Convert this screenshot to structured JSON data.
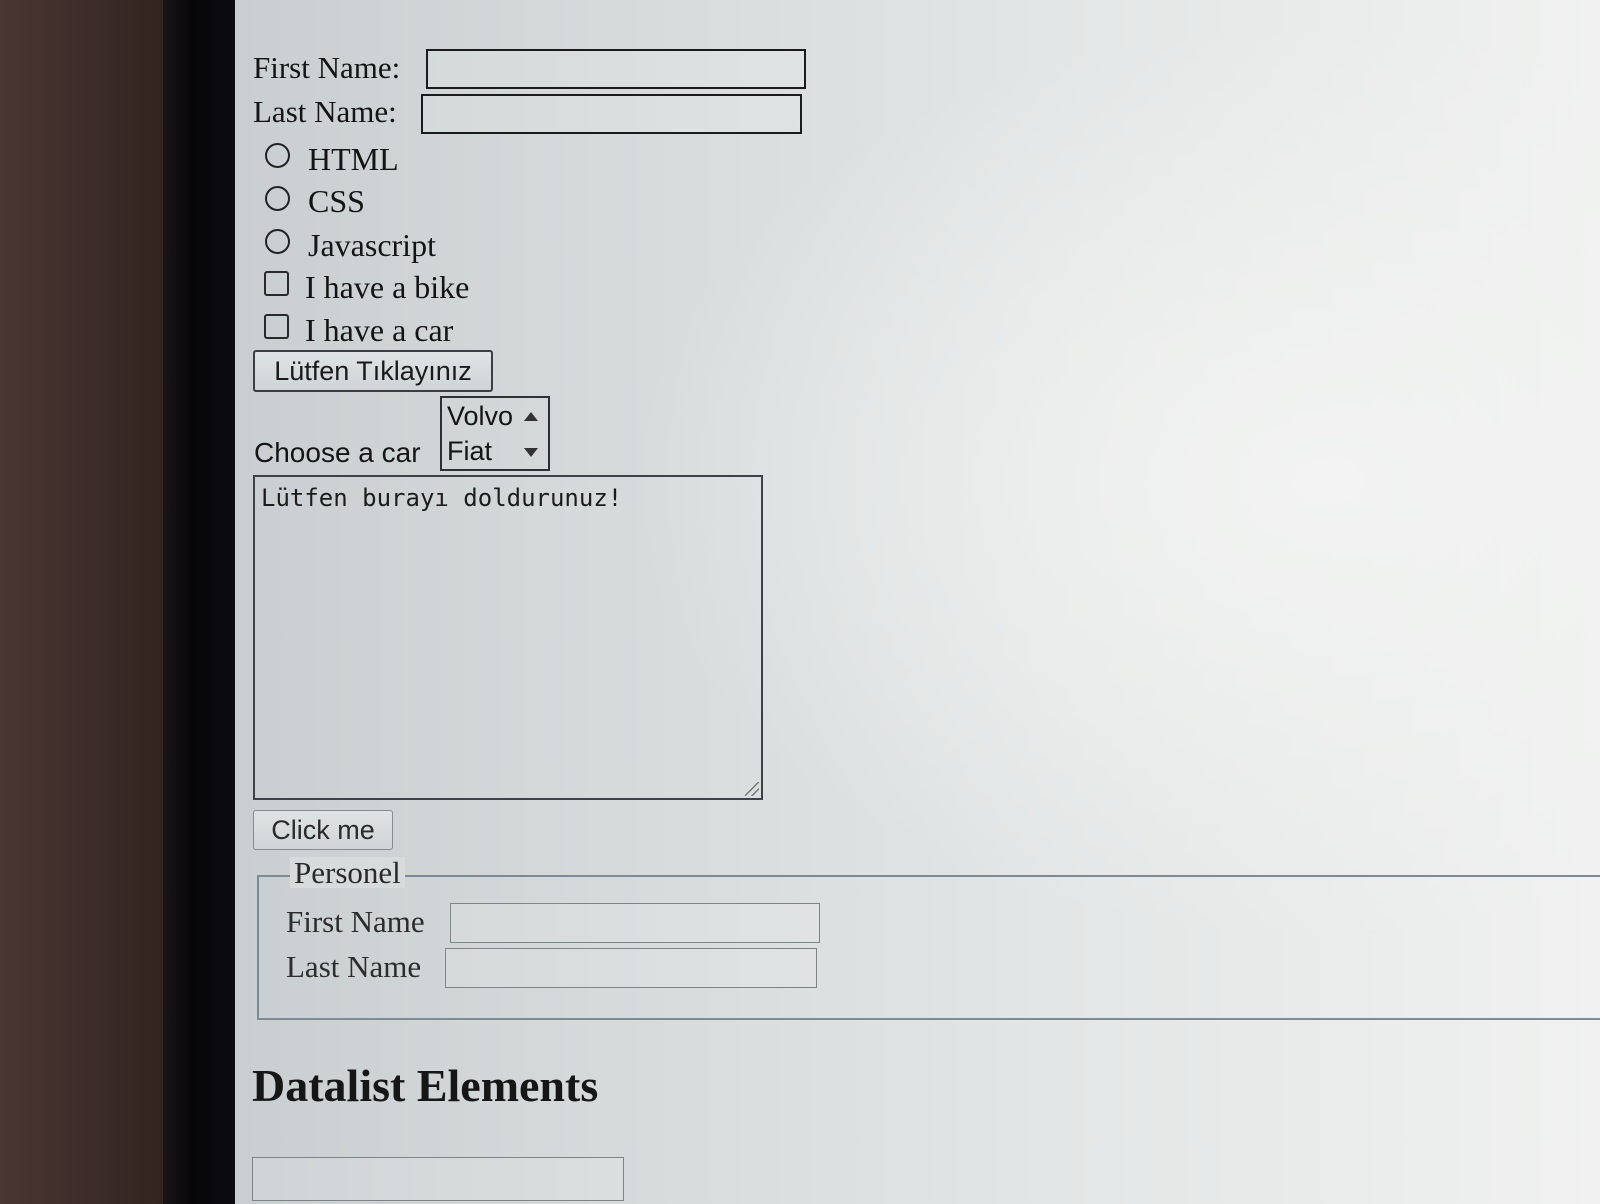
{
  "form": {
    "first_name_label": "First Name:",
    "last_name_label": "Last Name:",
    "radios": [
      {
        "label": "HTML"
      },
      {
        "label": "CSS"
      },
      {
        "label": "Javascript"
      }
    ],
    "checkboxes": [
      {
        "label": "I have a bike"
      },
      {
        "label": "I have a car"
      }
    ],
    "submit_button_label": "Lütfen Tıklayınız",
    "car_select": {
      "label": "Choose a car",
      "visible_options": [
        "Volvo",
        "Fiat"
      ]
    },
    "textarea_text": "Lütfen burayı doldurunuz!",
    "click_button_label": "Click me"
  },
  "fieldset": {
    "legend": "Personel",
    "first_name_label": "First Name",
    "last_name_label": "Last Name"
  },
  "datalist": {
    "heading": "Datalist Elements"
  }
}
